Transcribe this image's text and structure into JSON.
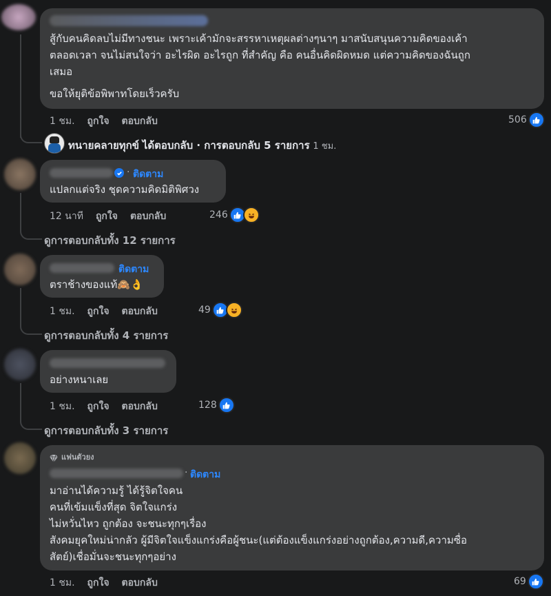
{
  "comment1": {
    "text_lines": [
      "สู้กับคนคิดลบไม่มีทางชนะ เพราะเค้ามักจะสรรหาเหตุผลต่างๆนาๆ มาสนับสนุนความคิดของเค้า",
      "ตลอดเวลา จนไม่สนใจว่า อะไรผิด อะไรถูก ที่สำคัญ คือ คนอื่นคิดผิดหมด แต่ความคิดของฉันถูก",
      "เสมอ"
    ],
    "text_last": "ขอให้ยุติข้อพิพาทโดยเร็วครับ",
    "time": "1 ชม.",
    "like_label": "ถูกใจ",
    "reply_label": "ตอบกลับ",
    "reactions": "506"
  },
  "reply_summary": {
    "name": "ทนายคลายทุกข์",
    "action": "ได้ตอบกลับ · การตอบกลับ 5 รายการ",
    "time": "1 ชม."
  },
  "comment2": {
    "follow": "ติดตาม",
    "text": "แปลกแต่จริง ชุดความคิดมิติพิศวง",
    "time": "12 นาที",
    "like_label": "ถูกใจ",
    "reply_label": "ตอบกลับ",
    "reactions": "246",
    "view_replies": "ดูการตอบกลับทั้ง 12 รายการ"
  },
  "comment3": {
    "follow": "ติดตาม",
    "text": "ตราช้างของแท้🙈👌",
    "time": "1 ชม.",
    "like_label": "ถูกใจ",
    "reply_label": "ตอบกลับ",
    "reactions": "49",
    "view_replies": "ดูการตอบกลับทั้ง 4 รายการ"
  },
  "comment4": {
    "text": "อย่างหนาเลย",
    "time": "1 ชม.",
    "like_label": "ถูกใจ",
    "reply_label": "ตอบกลับ",
    "reactions": "128",
    "view_replies": "ดูการตอบกลับทั้ง 3 รายการ"
  },
  "comment5": {
    "badge": "แฟนตัวยง",
    "follow": "ติดตาม",
    "text_lines": [
      "มาอ่านได้ความรู้ ได้รู้จิตใจคน",
      "คนที่เข้มแข็งที่สุด จิตใจแกร่ง",
      "ไม่หวั่นไหว ถูกต้อง จะชนะทุกๆเรื่อง",
      "สังคมยุคใหม่น่ากลัว ผู้มีจิตใจแข็งแกร่งคือผู้ชนะ(แต่ต้องแข็งแกร่งอย่างถูกต้อง,ความดี,ความซื่อ",
      "สัตย์)เชื่อมั่นจะชนะทุกๆอย่าง"
    ],
    "time": "1 ชม.",
    "like_label": "ถูกใจ",
    "reply_label": "ตอบกลับ",
    "reactions": "69"
  },
  "colors": {
    "background": "#18191a",
    "bubble": "#3a3b3c",
    "link": "#2d88ff",
    "like_blue": "#1877f2",
    "muted": "#b0b3b8"
  },
  "icons": [
    "like-icon",
    "haha-icon",
    "verified-icon",
    "diamond-icon"
  ]
}
